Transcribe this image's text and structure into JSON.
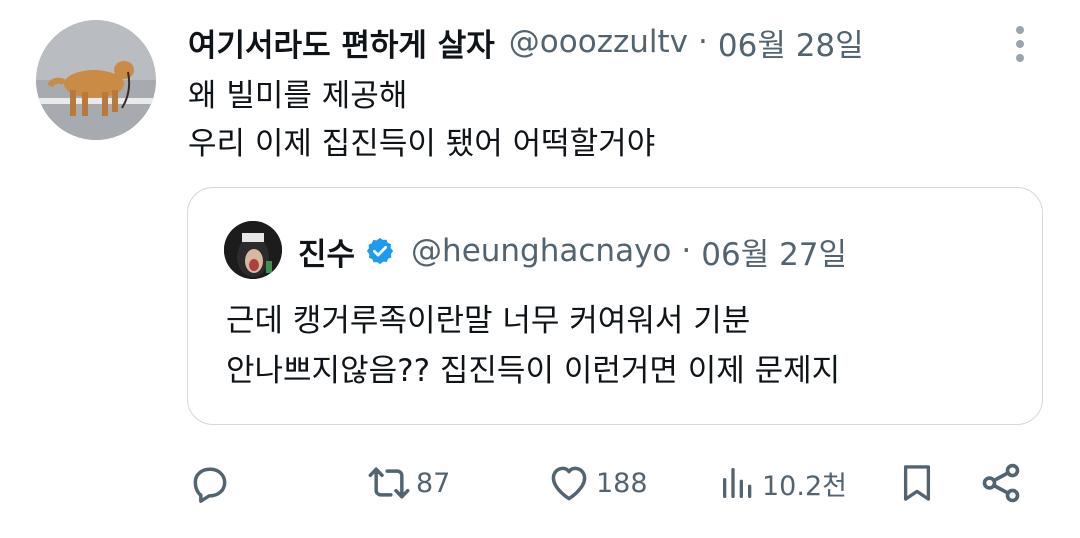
{
  "tweet": {
    "author": {
      "display_name": "여기서라도 편하게 살자",
      "handle": "@ooozzultv",
      "separator": "·",
      "date": "06월 28일",
      "avatar_icon": "dog-walking-avatar"
    },
    "text_lines": [
      "왜 빌미를 제공해",
      "우리 이제 집진득이 됐어 어떡할거야"
    ],
    "more_icon": "more-vertical-icon"
  },
  "quote": {
    "author": {
      "display_name": "진수",
      "verified": true,
      "handle": "@heunghacnayo",
      "separator": "·",
      "date": "06월 27일",
      "avatar_icon": "monkey-avatar"
    },
    "text_lines": [
      "근데 캥거루족이란말 너무 커여워서 기분",
      "안나쁘지않음?? 집진득이 이런거면 이제 문제지"
    ]
  },
  "actions": {
    "reply": {
      "icon": "reply-icon",
      "count": ""
    },
    "retweet": {
      "icon": "retweet-icon",
      "count": "87"
    },
    "like": {
      "icon": "heart-icon",
      "count": "188"
    },
    "views": {
      "icon": "views-icon",
      "count": "10.2천"
    },
    "bookmark": {
      "icon": "bookmark-icon"
    },
    "share": {
      "icon": "share-icon"
    }
  },
  "colors": {
    "text_primary": "#0f1419",
    "text_secondary": "#536471",
    "border": "#cfd9de",
    "verified_blue": "#1d9bf0"
  }
}
